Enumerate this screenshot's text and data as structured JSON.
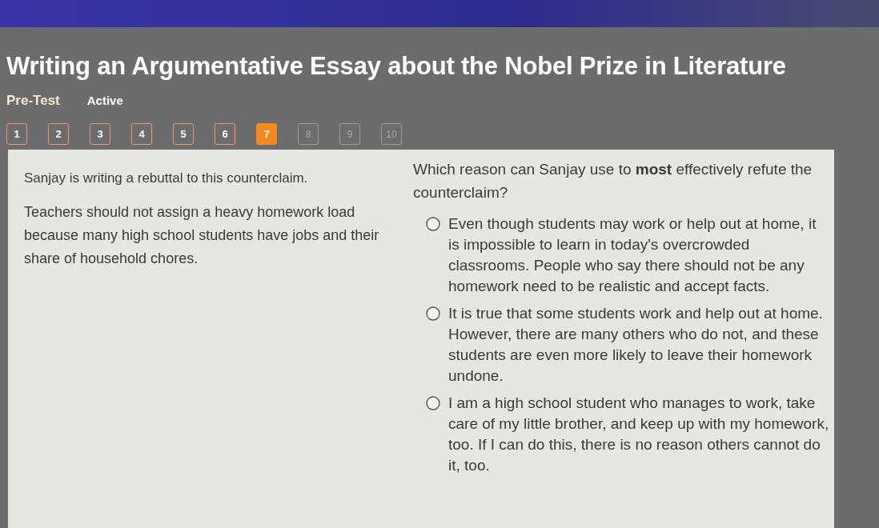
{
  "header": {
    "title": "Writing an Argumentative Essay about the Nobel Prize in Literature",
    "test_type": "Pre-Test",
    "status": "Active"
  },
  "question_nav": [
    {
      "label": "1",
      "answered": true,
      "selected": false
    },
    {
      "label": "2",
      "answered": true,
      "selected": false
    },
    {
      "label": "3",
      "answered": true,
      "selected": false
    },
    {
      "label": "4",
      "answered": true,
      "selected": false
    },
    {
      "label": "5",
      "answered": true,
      "selected": false
    },
    {
      "label": "6",
      "answered": true,
      "selected": false
    },
    {
      "label": "7",
      "answered": false,
      "selected": true
    },
    {
      "label": "8",
      "answered": false,
      "selected": false
    },
    {
      "label": "9",
      "answered": false,
      "selected": false
    },
    {
      "label": "10",
      "answered": false,
      "selected": false
    }
  ],
  "passage": {
    "intro": "Sanjay is writing a rebuttal to this counterclaim.",
    "counterclaim": "Teachers should not assign a heavy homework load because many high school students have jobs and their share of household chores."
  },
  "question": {
    "prompt": "Which reason can Sanjay use to **most** effectively refute the counterclaim?",
    "options": [
      {
        "text": "Even though students may work or help out at home, it is impossible to learn in today's overcrowded classrooms. People who say there should not be any homework need to be realistic and accept facts.",
        "selected": false
      },
      {
        "text": "It is true that some students work and help out at home. However, there are many others who do not, and these students are even more likely to leave their homework undone.",
        "selected": false
      },
      {
        "text": "I am a high school student who manages to work, take care of my little brother, and keep up with my homework, too. If I can do this, there is no reason others cannot do it, too.",
        "selected": false
      }
    ]
  }
}
